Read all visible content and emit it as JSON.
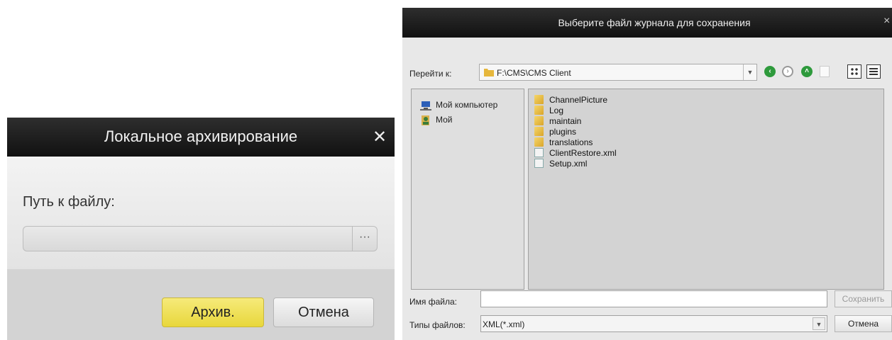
{
  "archive_dialog": {
    "title": "Локальное архивирование",
    "close_glyph": "✕",
    "path_label": "Путь к файлу:",
    "path_value": "",
    "browse_label": "···",
    "archive_button": "Архив.",
    "cancel_button": "Отмена"
  },
  "save_dialog": {
    "title": "Выберите файл журнала для сохранения",
    "close_glyph": "×",
    "lookin_label": "Перейти к:",
    "lookin_value": "F:\\CMS\\CMS Client",
    "sidebar": [
      {
        "label": "Мой компьютер",
        "icon": "computer-icon"
      },
      {
        "label": "Мой",
        "icon": "user-icon"
      }
    ],
    "files": [
      {
        "name": "ChannelPicture",
        "type": "folder"
      },
      {
        "name": "Log",
        "type": "folder"
      },
      {
        "name": "maintain",
        "type": "folder"
      },
      {
        "name": "plugins",
        "type": "folder"
      },
      {
        "name": "translations",
        "type": "folder"
      },
      {
        "name": "ClientRestore.xml",
        "type": "xml"
      },
      {
        "name": "Setup.xml",
        "type": "xml"
      }
    ],
    "filename_label": "Имя файла:",
    "filename_value": "",
    "save_button": "Сохранить",
    "filetype_label": "Типы файлов:",
    "filetype_value": "XML(*.xml)",
    "cancel_button": "Отмена"
  }
}
